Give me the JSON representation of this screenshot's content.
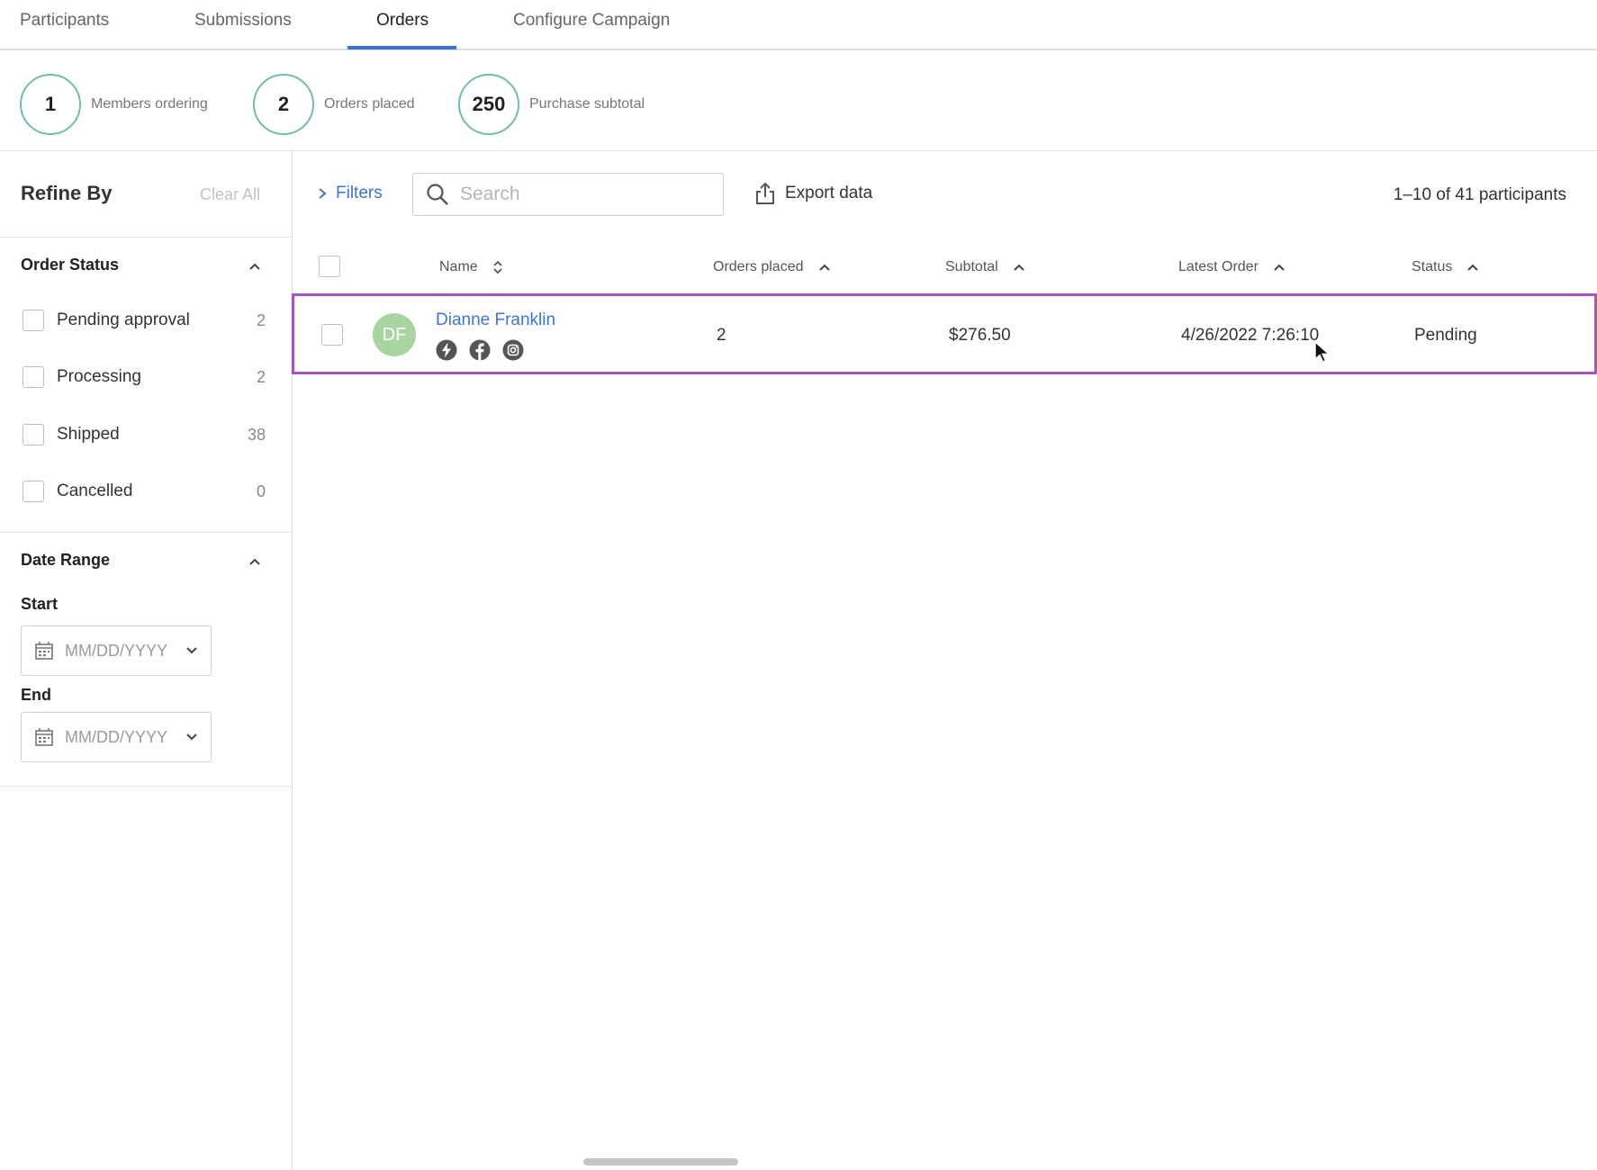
{
  "tabs": [
    {
      "label": "Participants"
    },
    {
      "label": "Submissions"
    },
    {
      "label": "Orders",
      "active": true
    },
    {
      "label": "Configure Campaign"
    }
  ],
  "stats": [
    {
      "value": "1",
      "label": "Members ordering"
    },
    {
      "value": "2",
      "label": "Orders placed"
    },
    {
      "value": "250",
      "label": "Purchase subtotal"
    }
  ],
  "sidebar": {
    "title": "Refine By",
    "clear_all": "Clear All",
    "order_status": {
      "title": "Order Status",
      "items": [
        {
          "label": "Pending approval",
          "count": "2"
        },
        {
          "label": "Processing",
          "count": "2"
        },
        {
          "label": "Shipped",
          "count": "38"
        },
        {
          "label": "Cancelled",
          "count": "0"
        }
      ]
    },
    "date_range": {
      "title": "Date Range",
      "start_label": "Start",
      "end_label": "End",
      "placeholder": "MM/DD/YYYY"
    }
  },
  "toolbar": {
    "filters_label": "Filters",
    "search_placeholder": "Search",
    "export_label": "Export data",
    "count_text": "1–10 of 41 participants"
  },
  "table": {
    "headers": {
      "name": "Name",
      "orders_placed": "Orders placed",
      "subtotal": "Subtotal",
      "latest_order": "Latest Order",
      "status": "Status"
    },
    "rows": [
      {
        "initials": "DF",
        "name": "Dianne Franklin",
        "social_icons": [
          "bolt-icon",
          "facebook-icon",
          "instagram-icon"
        ],
        "orders_placed": "2",
        "subtotal": "$276.50",
        "latest_order": "4/26/2022 7:26:10",
        "status": "Pending"
      }
    ]
  },
  "colors": {
    "accent_blue": "#3b73d9",
    "stat_ring": "#6fbfa6",
    "row_highlight": "#a952c2",
    "avatar_bg": "#a9d5a1"
  }
}
